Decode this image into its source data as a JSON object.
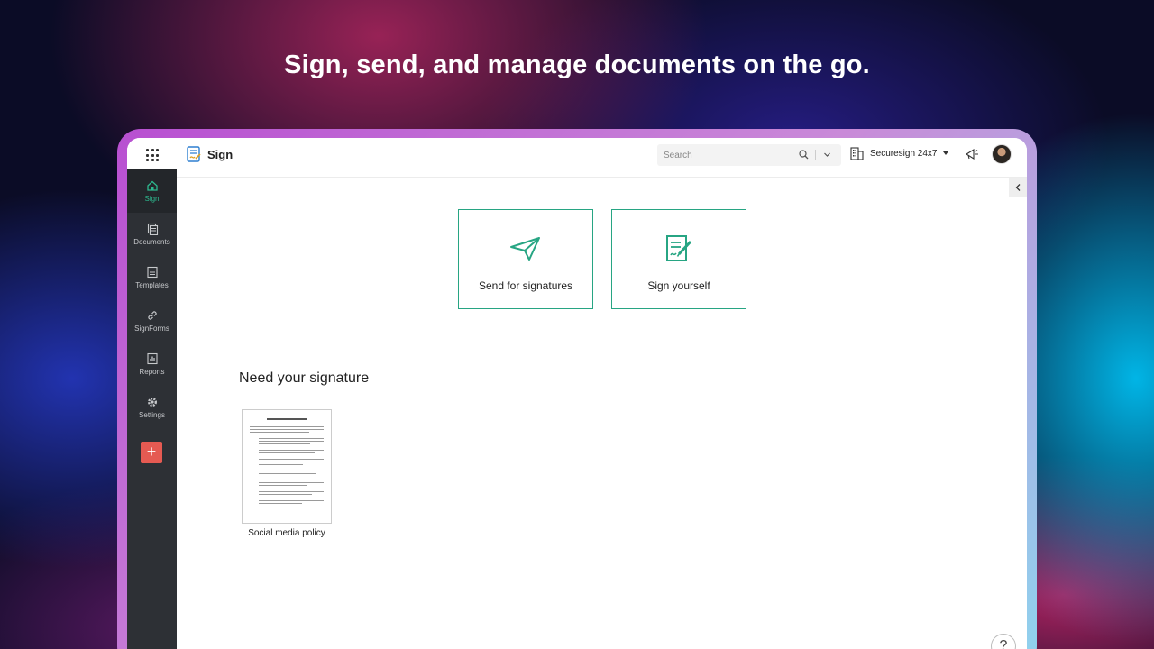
{
  "headline": "Sign, send, and manage documents on the go.",
  "app": {
    "name": "Sign"
  },
  "search": {
    "placeholder": "Search"
  },
  "org": {
    "name": "Securesign 24x7"
  },
  "sidebar": {
    "items": [
      {
        "label": "Sign",
        "icon": "home-icon",
        "active": true
      },
      {
        "label": "Documents",
        "icon": "documents-icon",
        "active": false
      },
      {
        "label": "Templates",
        "icon": "templates-icon",
        "active": false
      },
      {
        "label": "SignForms",
        "icon": "link-icon",
        "active": false
      },
      {
        "label": "Reports",
        "icon": "reports-icon",
        "active": false
      },
      {
        "label": "Settings",
        "icon": "gear-icon",
        "active": false
      }
    ],
    "add_label": "+"
  },
  "actions": [
    {
      "label": "Send for signatures",
      "icon": "paper-plane-icon"
    },
    {
      "label": "Sign yourself",
      "icon": "sign-document-icon"
    }
  ],
  "section": {
    "title": "Need your signature"
  },
  "documents": [
    {
      "name": "Social media policy"
    }
  ],
  "help": {
    "label": "?"
  },
  "colors": {
    "accent": "#27a583",
    "sidebar": "#2d3035",
    "add_button": "#e55a52"
  }
}
